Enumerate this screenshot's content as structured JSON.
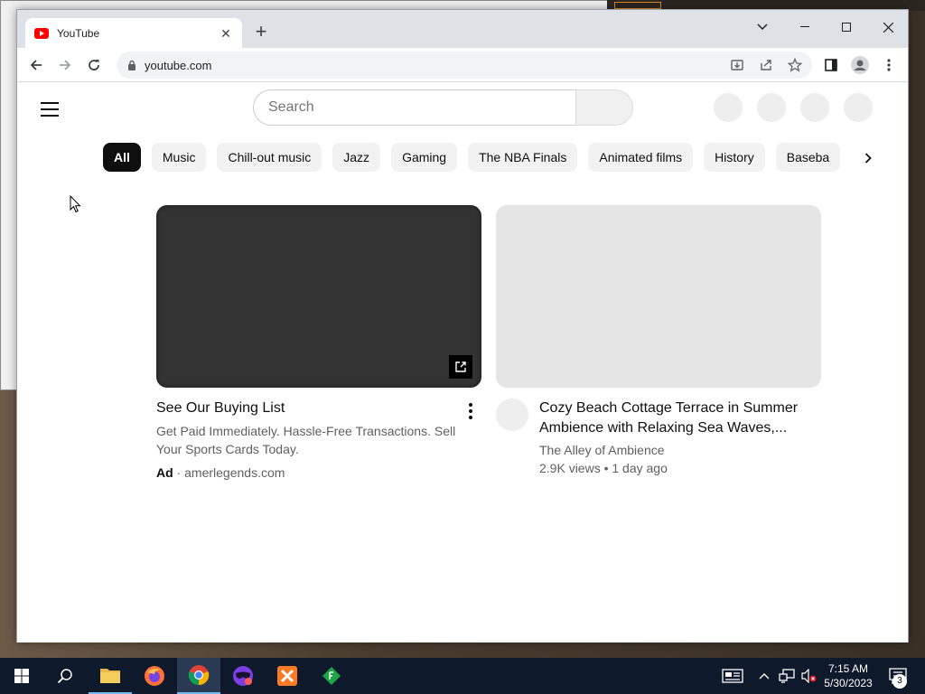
{
  "browser": {
    "tab_title": "YouTube",
    "url": "youtube.com"
  },
  "youtube": {
    "search_placeholder": "Search",
    "chips": [
      "All",
      "Music",
      "Chill-out music",
      "Jazz",
      "Gaming",
      "The NBA Finals",
      "Animated films",
      "History",
      "Baseba"
    ],
    "active_chip": "All",
    "cards": [
      {
        "title": "See Our Buying List",
        "description": "Get Paid Immediately. Hassle-Free Transactions. Sell Your Sports Cards Today.",
        "ad_label": "Ad",
        "ad_sep": " · ",
        "advertiser": "amerlegends.com"
      },
      {
        "title": "Cozy Beach Cottage Terrace in Summer Ambience with Relaxing Sea Waves,...",
        "channel": "The Alley of Ambience",
        "meta": "2.9K views • 1 day ago"
      }
    ]
  },
  "taskbar": {
    "time": "7:15 AM",
    "date": "5/30/2023",
    "notification_count": "3"
  },
  "colors": {
    "yt_red": "#ff0000",
    "chip_active_bg": "#0f0f0f",
    "taskbar_bg": "#0e1a2b"
  }
}
